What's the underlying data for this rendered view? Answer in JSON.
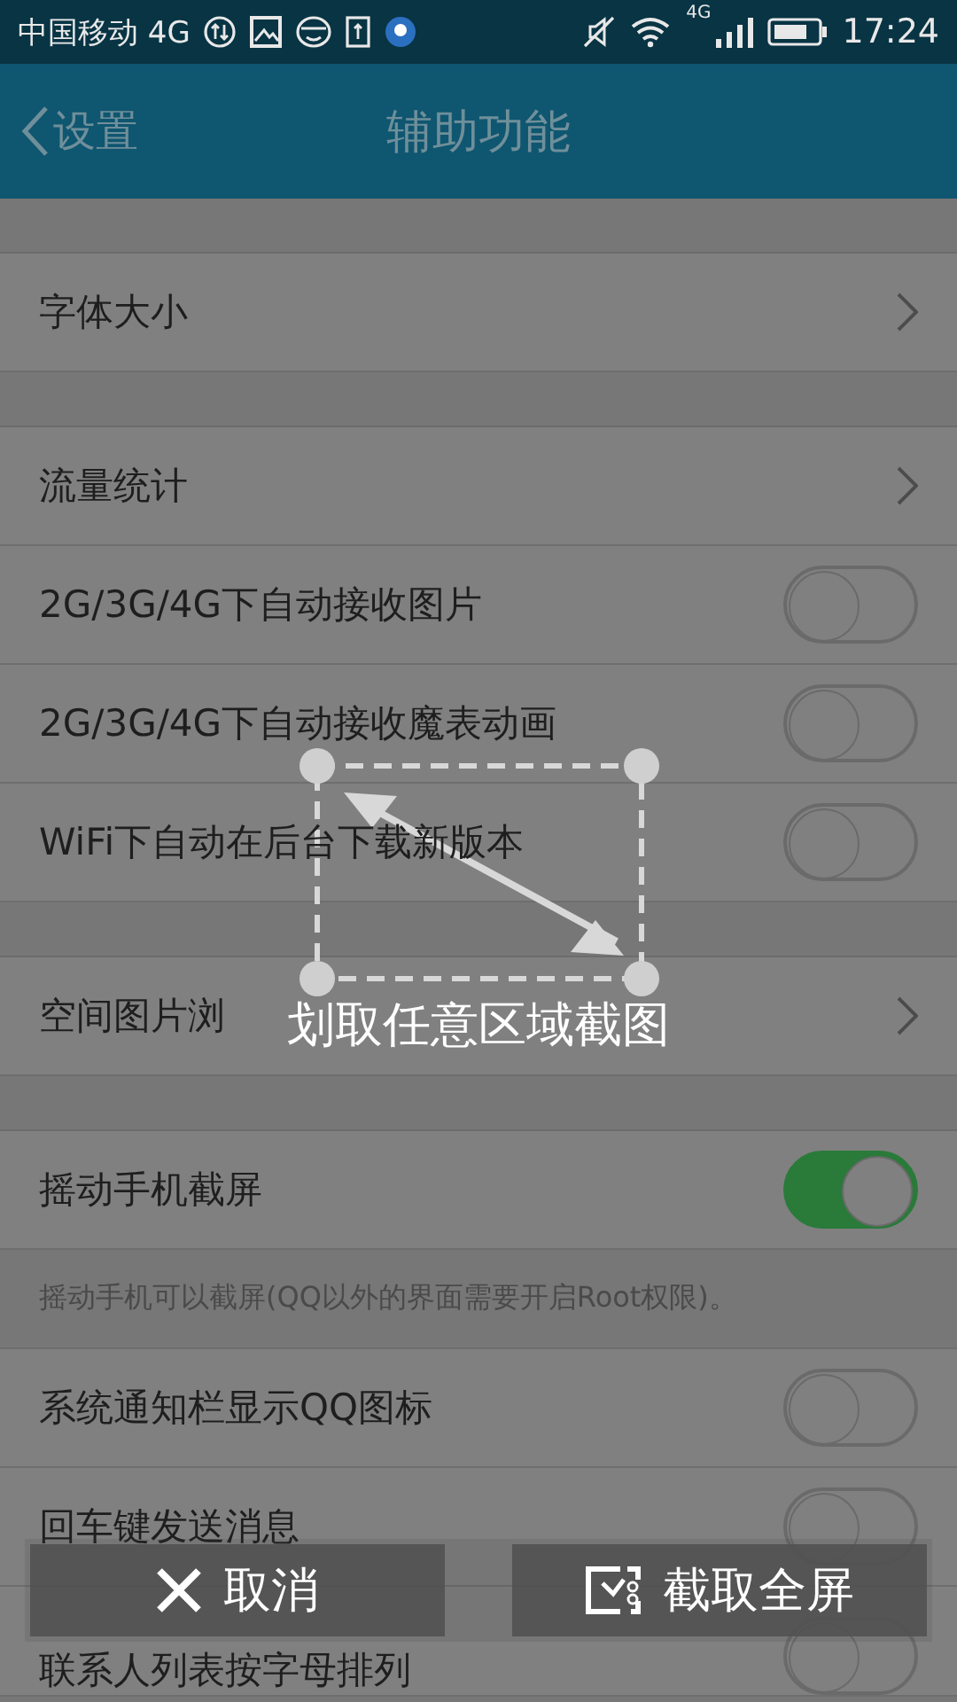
{
  "status_bar": {
    "carrier": "中国移动 4G",
    "network": "4G",
    "time": "17:24"
  },
  "header": {
    "back": "设置",
    "title": "辅助功能"
  },
  "sections": [
    {
      "rows": [
        {
          "kind": "link",
          "label": "字体大小"
        }
      ]
    },
    {
      "rows": [
        {
          "kind": "link",
          "label": "流量统计"
        },
        {
          "kind": "toggle",
          "label": "2G/3G/4G下自动接收图片",
          "on": false
        },
        {
          "kind": "toggle",
          "label": "2G/3G/4G下自动接收魔表动画",
          "on": false
        },
        {
          "kind": "toggle",
          "label": "WiFi下自动在后台下载新版本",
          "on": false
        }
      ]
    },
    {
      "rows": [
        {
          "kind": "link",
          "label": "空间图片浏"
        }
      ]
    },
    {
      "rows": [
        {
          "kind": "toggle",
          "label": "摇动手机截屏",
          "on": true
        },
        {
          "kind": "note",
          "label": "摇动手机可以截屏(QQ以外的界面需要开启Root权限)。"
        },
        {
          "kind": "toggle",
          "label": "系统通知栏显示QQ图标",
          "on": false
        },
        {
          "kind": "toggle",
          "label": "回车键发送消息",
          "on": false
        },
        {
          "kind": "toggle",
          "label": "联系人列表按字母排列",
          "on": false
        }
      ]
    }
  ],
  "screenshot_overlay": {
    "hint": "划取任意区域截图",
    "cancel": "取消",
    "capture_full": "截取全屏"
  }
}
